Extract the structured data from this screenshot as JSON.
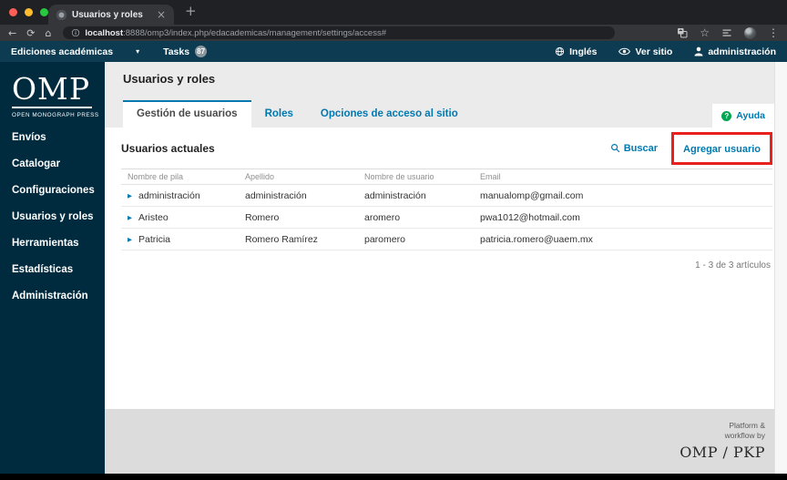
{
  "browser": {
    "tab_title": "Usuarios y roles",
    "url_host": "localhost",
    "url_path": ":8888/omp3/index.php/edacademicas/management/settings/access#"
  },
  "icons": {
    "close": "×",
    "new_tab": "+",
    "back": "←",
    "reload": "⟳",
    "home": "⌂",
    "star": "☆",
    "overflow_menu": "⋮",
    "caret_down": "▾",
    "row_expand": "▶",
    "help_mark": "?"
  },
  "topbar": {
    "context": "Ediciones académicas",
    "tasks_label": "Tasks",
    "tasks_count": "87",
    "language": "Inglés",
    "view_site": "Ver sitio",
    "user": "administración"
  },
  "sidebar": {
    "logo_title": "OMP",
    "logo_subtitle": "OPEN MONOGRAPH PRESS",
    "items": [
      {
        "label": "Envíos"
      },
      {
        "label": "Catalogar"
      },
      {
        "label": "Configuraciones"
      },
      {
        "label": "Usuarios y roles"
      },
      {
        "label": "Herramientas"
      },
      {
        "label": "Estadísticas"
      },
      {
        "label": "Administración"
      }
    ]
  },
  "main": {
    "page_title": "Usuarios y roles",
    "tabs": [
      {
        "label": "Gestión de usuarios",
        "active": true
      },
      {
        "label": "Roles",
        "active": false
      },
      {
        "label": "Opciones de acceso al sitio",
        "active": false
      }
    ],
    "help_label": "Ayuda",
    "grid": {
      "title": "Usuarios actuales",
      "search_label": "Buscar",
      "add_label": "Agregar usuario",
      "columns": [
        "Nombre de pila",
        "Apellido",
        "Nombre de usuario",
        "Email"
      ],
      "rows": [
        [
          "administración",
          "administración",
          "administración",
          "manualomp@gmail.com"
        ],
        [
          "Aristeo",
          "Romero",
          "aromero",
          "pwa1012@hotmail.com"
        ],
        [
          "Patricia",
          "Romero Ramírez",
          "paromero",
          "patricia.romero@uaem.mx"
        ]
      ],
      "pagination": "1 - 3 de 3 artículos"
    }
  },
  "footer": {
    "line1": "Platform &",
    "line2": "workflow by",
    "brand": "OMP / PKP"
  },
  "colors": {
    "accent_blue": "#0079b1",
    "annotation_red": "#e8201e",
    "help_green": "#00a651",
    "topbar_teal": "#0d3c52",
    "sidebar_navy": "#002b3f"
  }
}
